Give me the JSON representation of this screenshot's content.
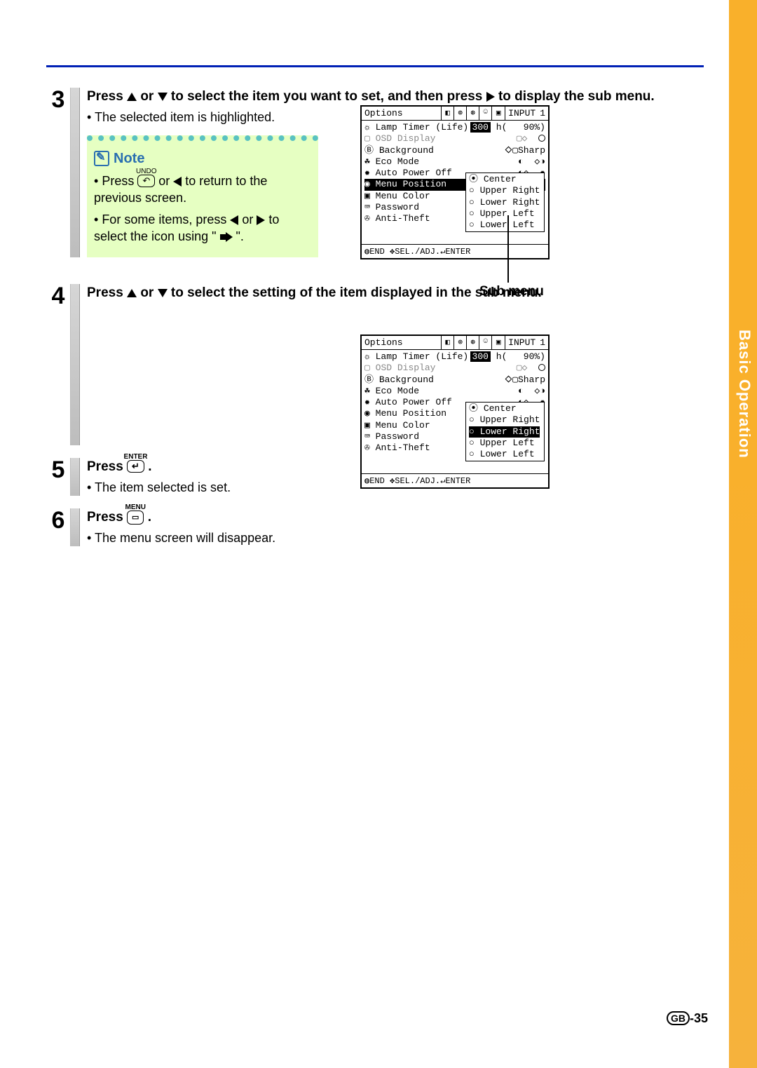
{
  "page": {
    "section_tab": "Basic Operation",
    "page_number": "-35",
    "page_lang": "GB"
  },
  "steps": {
    "s3": {
      "num": "3",
      "title_a": "Press ",
      "title_b": " or ",
      "title_c": " to select the item you want to set, and then press ",
      "title_d": " to display the sub menu.",
      "sub1": "The selected item is highlighted.",
      "note_label": "Note",
      "note1a": "Press ",
      "note1_key": "UNDO",
      "note1b": " or ",
      "note1c": " to return to the previous screen.",
      "note2a": "For some items, press ",
      "note2b": " or ",
      "note2c": " to select the icon using \" ",
      "note2d": " \"."
    },
    "s4": {
      "num": "4",
      "title_a": "Press ",
      "title_b": " or ",
      "title_c": " to select the setting of the item displayed in the sub menu."
    },
    "s5": {
      "num": "5",
      "title": "Press ",
      "key": "ENTER",
      "sub": "The item selected is set."
    },
    "s6": {
      "num": "6",
      "title": "Press ",
      "key": "MENU",
      "sub": "The menu screen will disappear."
    }
  },
  "osd": {
    "title": "Options",
    "input_label": "INPUT",
    "input_num": "1",
    "rows": {
      "lamp": "Lamp Timer (Life)",
      "lamp_val": "300",
      "lamp_unit": "h(",
      "lamp_pct": "90%)",
      "osd_display": "OSD Display",
      "background": "Background",
      "bg_val": "Sharp",
      "eco": "Eco Mode",
      "auto": "Auto Power Off",
      "menu_pos": "Menu Position",
      "menu_color": "Menu Color",
      "password": "Password",
      "anti_theft": "Anti-Theft"
    },
    "submenu_label": "Sub menu",
    "positions": {
      "center": "Center",
      "ur": "Upper Right",
      "lr": "Lower Right",
      "ul": "Upper Left",
      "ll": "Lower Left"
    },
    "footer_a": "END",
    "footer_b": "SEL./ADJ.",
    "footer_c": "ENTER"
  }
}
